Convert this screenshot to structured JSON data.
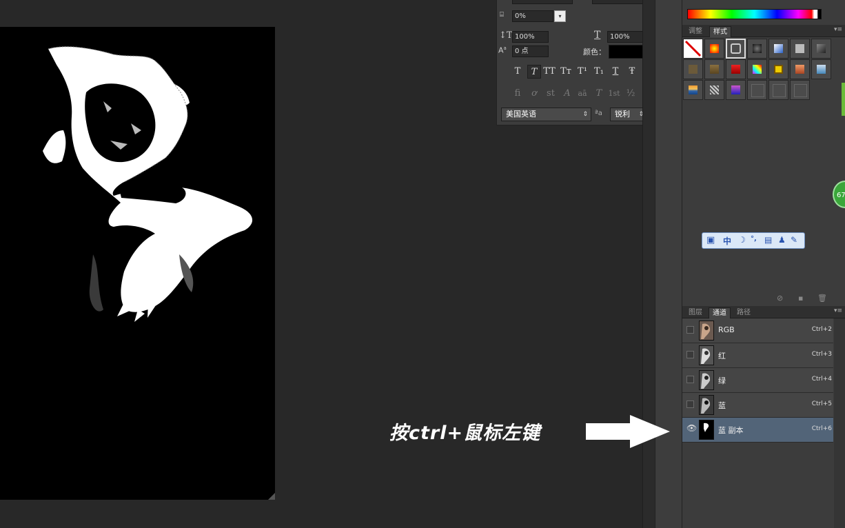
{
  "character_panel": {
    "tracking_value": "0%",
    "vscale_value": "100%",
    "hscale_value": "100%",
    "baseline_value": "0 点",
    "color_label": "颜色：",
    "type_buttons": [
      "T",
      "T",
      "TT",
      "Tт",
      "T¹",
      "T₁",
      "T",
      "Ŧ"
    ],
    "opentype_buttons": [
      "fi",
      "ơ",
      "st",
      "A",
      "aā",
      "T",
      "1st",
      "½"
    ],
    "language": "美国英语",
    "aa_icon": "ªa",
    "antialias": "锐利"
  },
  "styles_panel": {
    "tabs": [
      "调整",
      "样式"
    ],
    "active_tab": "样式"
  },
  "channels_panel": {
    "tabs": [
      "图层",
      "通道",
      "路径"
    ],
    "active_tab": "通道",
    "rows": [
      {
        "name": "RGB",
        "shortcut": "Ctrl+2",
        "visible": false,
        "selected": false
      },
      {
        "name": "红",
        "shortcut": "Ctrl+3",
        "visible": false,
        "selected": false
      },
      {
        "name": "绿",
        "shortcut": "Ctrl+4",
        "visible": false,
        "selected": false
      },
      {
        "name": "蓝",
        "shortcut": "Ctrl+5",
        "visible": false,
        "selected": false
      },
      {
        "name": "蓝 副本",
        "shortcut": "Ctrl+6",
        "visible": true,
        "selected": true
      }
    ]
  },
  "ime_toolbar": {
    "mode": "中",
    "punct": "°,"
  },
  "badge": {
    "value": "67"
  },
  "annotation": {
    "text": "按ctrl+鼠标左键"
  },
  "colors": {
    "selected_row": "#526478",
    "panel": "#3c3c3c",
    "canvas": "#000000",
    "accent_green": "#3aa63a"
  }
}
